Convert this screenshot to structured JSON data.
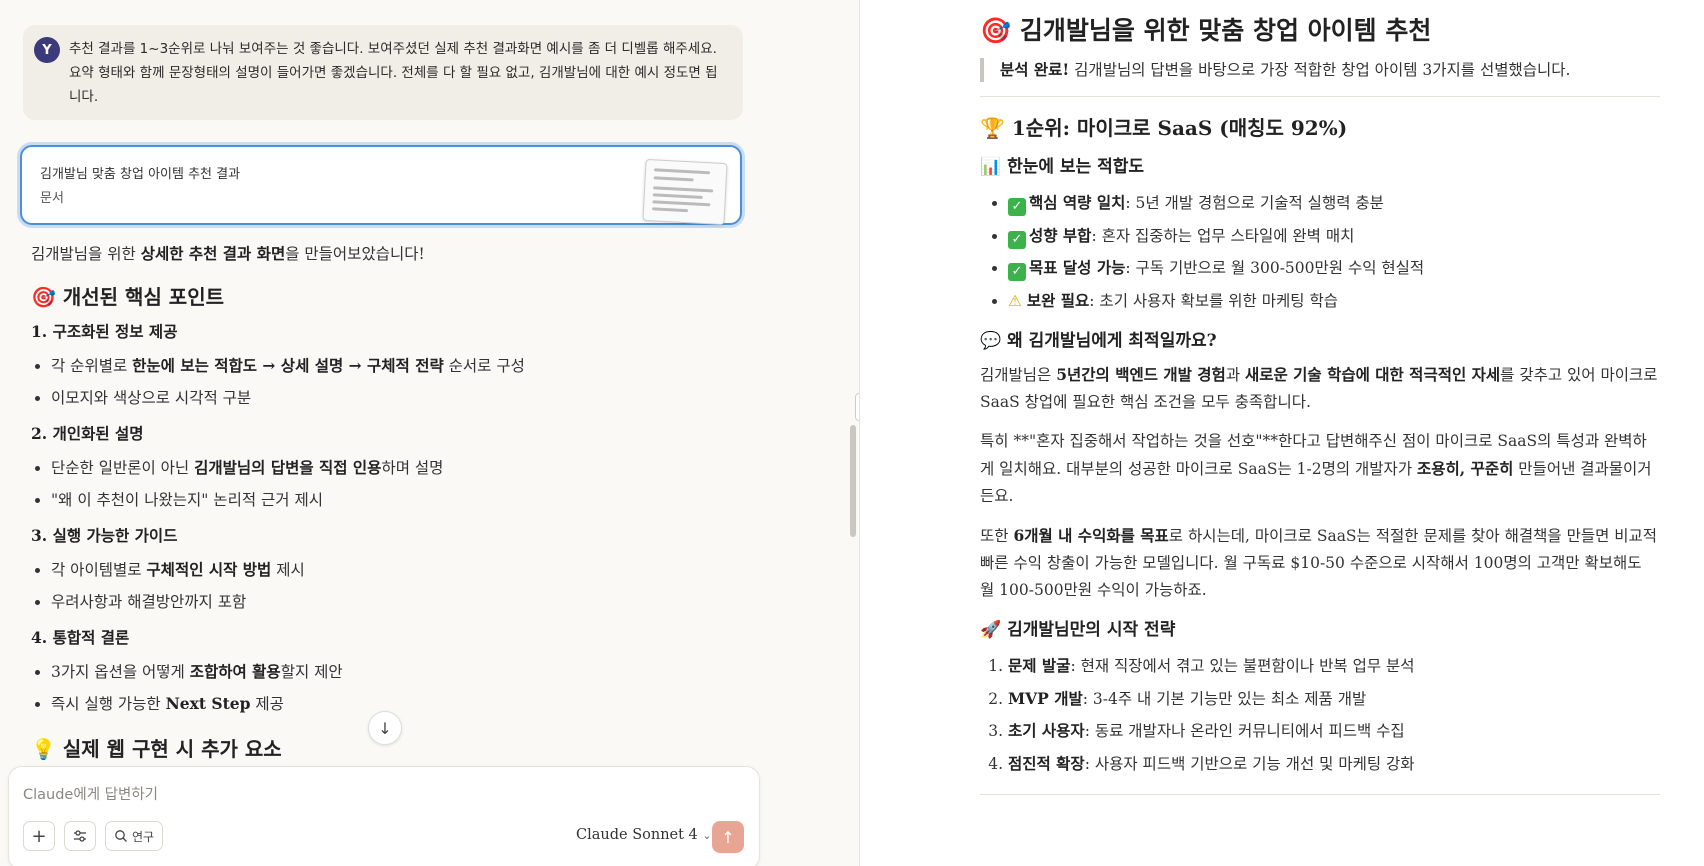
{
  "user_message": {
    "avatar": "Y",
    "text": "추천 결과를 1~3순위로 나눠 보여주는 것 좋습니다. 보여주셨던 실제 추천 결과화면 예시를 좀 더 디벨롭 해주세요. 요약 형태와 함께 문장형태의 설명이 들어가면 좋겠습니다. 전체를 다 할 필요 없고, 김개발님에 대한 예시 정도면 됩니다."
  },
  "artifact": {
    "title": "김개발님 맞춤 창업 아이템 추천 결과",
    "type_label": "문서"
  },
  "chat": {
    "intro_pre": "김개발님을 위한 ",
    "intro_bold": "상세한 추천 결과 화면",
    "intro_post": "을 만들어보았습니다!",
    "heading1_icon": "🎯",
    "heading1": "개선된 핵심 포인트",
    "sec1": {
      "title": "1. 구조화된 정보 제공",
      "i1_pre": "각 순위별로 ",
      "i1_bold": "한눈에 보는 적합도 → 상세 설명 → 구체적 전략",
      "i1_post": " 순서로 구성",
      "i2": "이모지와 색상으로 시각적 구분"
    },
    "sec2": {
      "title": "2. 개인화된 설명",
      "i1_pre": "단순한 일반론이 아닌 ",
      "i1_bold": "김개발님의 답변을 직접 인용",
      "i1_post": "하며 설명",
      "i2": "\"왜 이 추천이 나왔는지\" 논리적 근거 제시"
    },
    "sec3": {
      "title": "3. 실행 가능한 가이드",
      "i1_pre": "각 아이템별로 ",
      "i1_bold": "구체적인 시작 방법",
      "i1_post": " 제시",
      "i2": "우려사항과 해결방안까지 포함"
    },
    "sec4": {
      "title": "4. 통합적 결론",
      "i1_pre": "3가지 옵션을 어떻게 ",
      "i1_bold": "조합하여 활용",
      "i1_post": "할지 제안",
      "i2_pre": "즉시 실행 가능한 ",
      "i2_bold": "Next Step",
      "i2_post": " 제공"
    },
    "heading2_icon": "💡",
    "heading2": "실제 웹 구현 시 추가 요소"
  },
  "composer": {
    "placeholder": "Claude에게 답변하기",
    "research_label": "연구",
    "model": "Claude Sonnet 4"
  },
  "doc": {
    "title_icon": "🎯",
    "title": "김개발님을 위한 맞춤 창업 아이템 추천",
    "callout_bold": "분석 완료!",
    "callout_rest": " 김개발님의 답변을 바탕으로 가장 적합한 창업 아이템 3가지를 선별했습니다.",
    "rank1_icon": "🏆",
    "rank1_title": "1순위: 마이크로 SaaS (매칭도 92%)",
    "fit_icon": "📊",
    "fit_title": "한눈에 보는 적합도",
    "fit_items": [
      {
        "mark": "✓",
        "label": "핵심 역량 일치",
        "text": ": 5년 개발 경험으로 기술적 실행력 충분"
      },
      {
        "mark": "✓",
        "label": "성향 부합",
        "text": ": 혼자 집중하는 업무 스타일에 완벽 매치"
      },
      {
        "mark": "✓",
        "label": "목표 달성 가능",
        "text": ": 구독 기반으로 월 300-500만원 수익 현실적"
      },
      {
        "mark": "⚠",
        "label": "보완 필요",
        "text": ": 초기 사용자 확보를 위한 마케팅 학습"
      }
    ],
    "why_icon": "💬",
    "why_title": "왜 김개발님에게 최적일까요?",
    "p1_a": "김개발님은 ",
    "p1_b": "5년간의 백엔드 개발 경험",
    "p1_c": "과 ",
    "p1_d": "새로운 기술 학습에 대한 적극적인 자세",
    "p1_e": "를 갖추고 있어 마이크로 SaaS 창업에 필요한 핵심 조건을 모두 충족합니다.",
    "p2_a": "특히 **\"혼자 집중해서 작업하는 것을 선호\"**한다고 답변해주신 점이 마이크로 SaaS의 특성과 완벽하게 일치해요. 대부분의 성공한 마이크로 SaaS는 1-2명의 개발자가 ",
    "p2_b": "조용히, 꾸준히",
    "p2_c": " 만들어낸 결과물이거든요.",
    "p3_a": "또한 ",
    "p3_b": "6개월 내 수익화를 목표",
    "p3_c": "로 하시는데, 마이크로 SaaS는 적절한 문제를 찾아 해결책을 만들면 비교적 빠른 수익 창출이 가능한 모델입니다. 월 구독료 $10-50 수준으로 시작해서 100명의 고객만 확보해도 월 100-500만원 수익이 가능하죠.",
    "start_icon": "🚀",
    "start_title": "김개발님만의 시작 전략",
    "steps": [
      {
        "label": "문제 발굴",
        "text": ": 현재 직장에서 겪고 있는 불편함이나 반복 업무 분석"
      },
      {
        "label": "MVP 개발",
        "text": ": 3-4주 내 기본 기능만 있는 최소 제품 개발"
      },
      {
        "label": "초기 사용자",
        "text": ": 동료 개발자나 온라인 커뮤니티에서 피드백 수집"
      },
      {
        "label": "점진적 확장",
        "text": ": 사용자 피드백 기반으로 기능 개선 및 마케팅 강화"
      }
    ]
  },
  "colors": {
    "background": "#faf9f5",
    "user_bubble": "#f0eee6",
    "avatar": "#3b3a7a",
    "artifact_border": "#4a90d9",
    "send_button": "#e8a593",
    "check_green": "#3cb34a"
  }
}
